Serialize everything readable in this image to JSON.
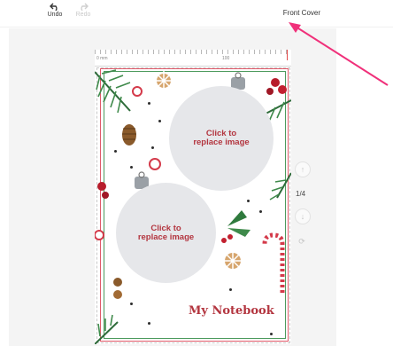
{
  "toolbar": {
    "undo_label": "Undo",
    "redo_label": "Redo",
    "front_cover_label": "Front Cover"
  },
  "ruler": {
    "label_start": "0 mm",
    "label_mid": "100"
  },
  "cover": {
    "image_placeholder_1": "Click to\nreplace image",
    "image_placeholder_2": "Click to\nreplace image",
    "title": "My Notebook"
  },
  "pager": {
    "indicator": "1/4"
  },
  "colors": {
    "accent_red": "#b3353f",
    "annotation_arrow": "#f0307a",
    "frame_green": "#4c9a5d"
  }
}
